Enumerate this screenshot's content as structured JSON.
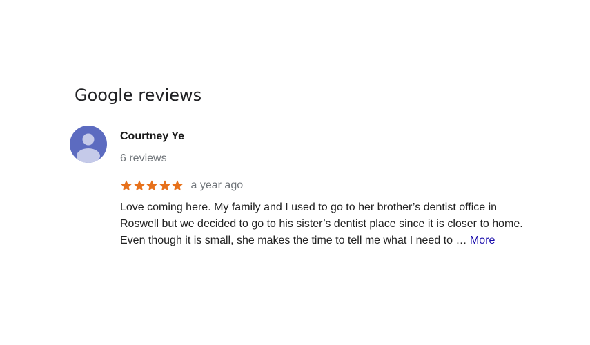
{
  "section": {
    "title": "Google reviews"
  },
  "review": {
    "reviewer_name": "Courtney Ye",
    "review_count": "6 reviews",
    "rating": 5,
    "rating_max": 5,
    "date": "a year ago",
    "text": "Love coming here. My family and I used to go to her brother’s dentist office in Roswell but we decided to go to his sister’s dentist place since it is closer to home. Even though it is small, she makes the time to tell me what I need to … ",
    "more_label": "More"
  },
  "colors": {
    "avatar_bg": "#5c6bc0",
    "avatar_fg": "#c5cae9",
    "star": "#e7711b",
    "link": "#1a0dab",
    "muted_text": "#70757a"
  },
  "icons": {
    "avatar": "person-icon",
    "star": "star-icon"
  }
}
